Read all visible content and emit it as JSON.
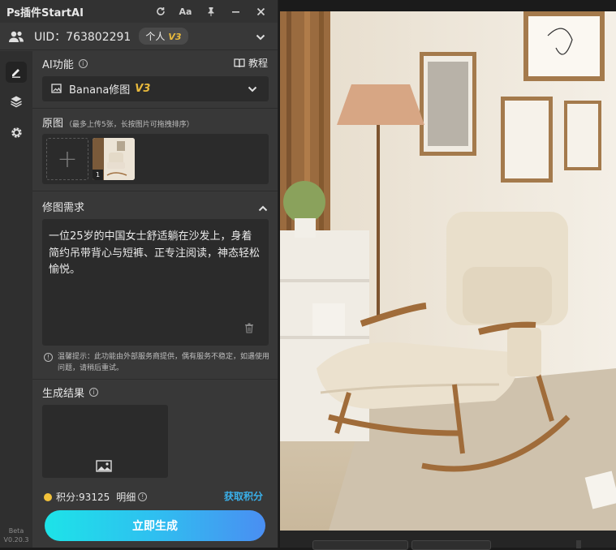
{
  "titlebar": {
    "title": "Ps插件StartAI",
    "icons": [
      "refresh-icon",
      "font-size-icon",
      "pin-icon",
      "minimize-icon",
      "close-icon"
    ],
    "font_label": "Aa"
  },
  "user": {
    "uid_label": "UID：763802291",
    "plan": "个人",
    "plan_version": "V3"
  },
  "ai_function": {
    "label": "AI功能",
    "tutorial": "教程",
    "selected": "Banana修图",
    "version": "V3"
  },
  "original": {
    "label": "原图",
    "hint": "（最多上传5张，长按图片可拖拽排序）",
    "thumb_index": "1"
  },
  "request": {
    "label": "修图需求",
    "text": "一位25岁的中国女士舒适躺在沙发上，身着简约吊带背心与短裤、正专注阅读，神态轻松愉悦。"
  },
  "notice": {
    "text": "温馨提示：此功能由外部服务商提供，偶有服务不稳定，如遇使用问题，请稍后重试。"
  },
  "result": {
    "label": "生成结果"
  },
  "points": {
    "label": "积分:93125",
    "detail": "明细",
    "get": "获取积分"
  },
  "generate_button": "立即生成",
  "beta": {
    "label": "Beta",
    "version": "V0.20.3"
  },
  "colors": {
    "panel_bg": "#383838",
    "input_bg": "#2b2b2b",
    "accent_gold": "#e8b93c",
    "link_blue": "#3ab0ea",
    "btn_start": "#1de3e8",
    "btn_end": "#4a8ef2"
  }
}
